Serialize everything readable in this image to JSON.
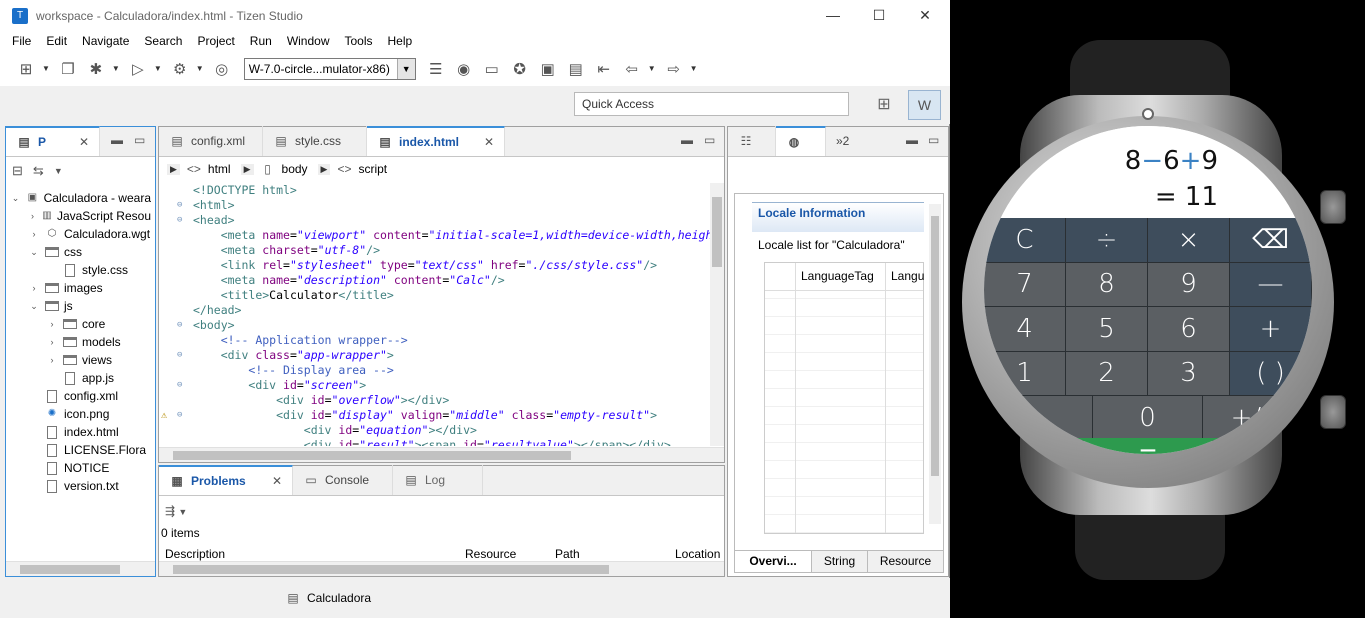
{
  "window": {
    "title": "workspace - Calculadora/index.html - Tizen Studio",
    "minimize": "—",
    "maximize": "☐",
    "close": "✕"
  },
  "menu": [
    "File",
    "Edit",
    "Navigate",
    "Search",
    "Project",
    "Run",
    "Window",
    "Tools",
    "Help"
  ],
  "toolbar": {
    "target_combo": "W-7.0-circle...mulator-x86)",
    "quick_access": "Quick Access"
  },
  "project_explorer": {
    "tab_label": "P",
    "items": [
      {
        "label": "Calculadora - weara",
        "indent": 0,
        "expander": "⌄",
        "kind": "project"
      },
      {
        "label": "JavaScript Resou",
        "indent": 1,
        "expander": "›",
        "kind": "lib"
      },
      {
        "label": "Calculadora.wgt",
        "indent": 1,
        "expander": "›",
        "kind": "wgt"
      },
      {
        "label": "css",
        "indent": 1,
        "expander": "⌄",
        "kind": "folder"
      },
      {
        "label": "style.css",
        "indent": 2,
        "expander": "",
        "kind": "file"
      },
      {
        "label": "images",
        "indent": 1,
        "expander": "›",
        "kind": "folder"
      },
      {
        "label": "js",
        "indent": 1,
        "expander": "⌄",
        "kind": "folder"
      },
      {
        "label": "core",
        "indent": 2,
        "expander": "›",
        "kind": "folder"
      },
      {
        "label": "models",
        "indent": 2,
        "expander": "›",
        "kind": "folder"
      },
      {
        "label": "views",
        "indent": 2,
        "expander": "›",
        "kind": "folder"
      },
      {
        "label": "app.js",
        "indent": 2,
        "expander": "",
        "kind": "file"
      },
      {
        "label": "config.xml",
        "indent": 1,
        "expander": "",
        "kind": "file"
      },
      {
        "label": "icon.png",
        "indent": 1,
        "expander": "",
        "kind": "image"
      },
      {
        "label": "index.html",
        "indent": 1,
        "expander": "",
        "kind": "file"
      },
      {
        "label": "LICENSE.Flora",
        "indent": 1,
        "expander": "",
        "kind": "file"
      },
      {
        "label": "NOTICE",
        "indent": 1,
        "expander": "",
        "kind": "file"
      },
      {
        "label": "version.txt",
        "indent": 1,
        "expander": "",
        "kind": "file"
      }
    ]
  },
  "editor": {
    "tabs": [
      {
        "label": "config.xml"
      },
      {
        "label": "style.css"
      },
      {
        "label": "index.html"
      }
    ],
    "breadcrumb": [
      "html",
      "body",
      "script"
    ]
  },
  "problems": {
    "tabs": [
      "Problems",
      "Console",
      "Log"
    ],
    "count": "0 items",
    "columns": [
      "Description",
      "Resource",
      "Path",
      "Location"
    ]
  },
  "right_panel": {
    "tab_extra": "»2",
    "title": "Locale Information",
    "subtitle": "Locale list for \"Calculadora\"",
    "columns": [
      "LanguageTag",
      "Langu"
    ],
    "bottom_tabs": [
      "Overvi...",
      "String",
      "Resource"
    ]
  },
  "status": {
    "project": "Calculadora"
  },
  "watch": {
    "equation": [
      "8",
      "−",
      "6",
      "+",
      "9"
    ],
    "result": "= 11",
    "equals_label": "=",
    "keys": [
      [
        {
          "t": "C",
          "c": "op"
        },
        {
          "t": "÷",
          "c": "op"
        },
        {
          "t": "×",
          "c": "op"
        },
        {
          "t": "⌫",
          "c": "op"
        }
      ],
      [
        {
          "t": "7",
          "c": "num"
        },
        {
          "t": "8",
          "c": "num"
        },
        {
          "t": "9",
          "c": "num"
        },
        {
          "t": "—",
          "c": "op"
        }
      ],
      [
        {
          "t": "4",
          "c": "num"
        },
        {
          "t": "5",
          "c": "num"
        },
        {
          "t": "6",
          "c": "num"
        },
        {
          "t": "+",
          "c": "op"
        }
      ],
      [
        {
          "t": "1",
          "c": "num"
        },
        {
          "t": "2",
          "c": "num"
        },
        {
          "t": "3",
          "c": "num"
        },
        {
          "t": "( )",
          "c": "op"
        }
      ],
      [
        {
          "t": ".",
          "c": "num"
        },
        {
          "t": "0",
          "c": "num"
        },
        {
          "t": "+/−",
          "c": "num"
        }
      ]
    ]
  },
  "colors": {
    "accent": "#3b8fd9",
    "op_key": "#3e4d5c",
    "num_key": "#5b5f63",
    "equals": "#2d9a4e"
  }
}
